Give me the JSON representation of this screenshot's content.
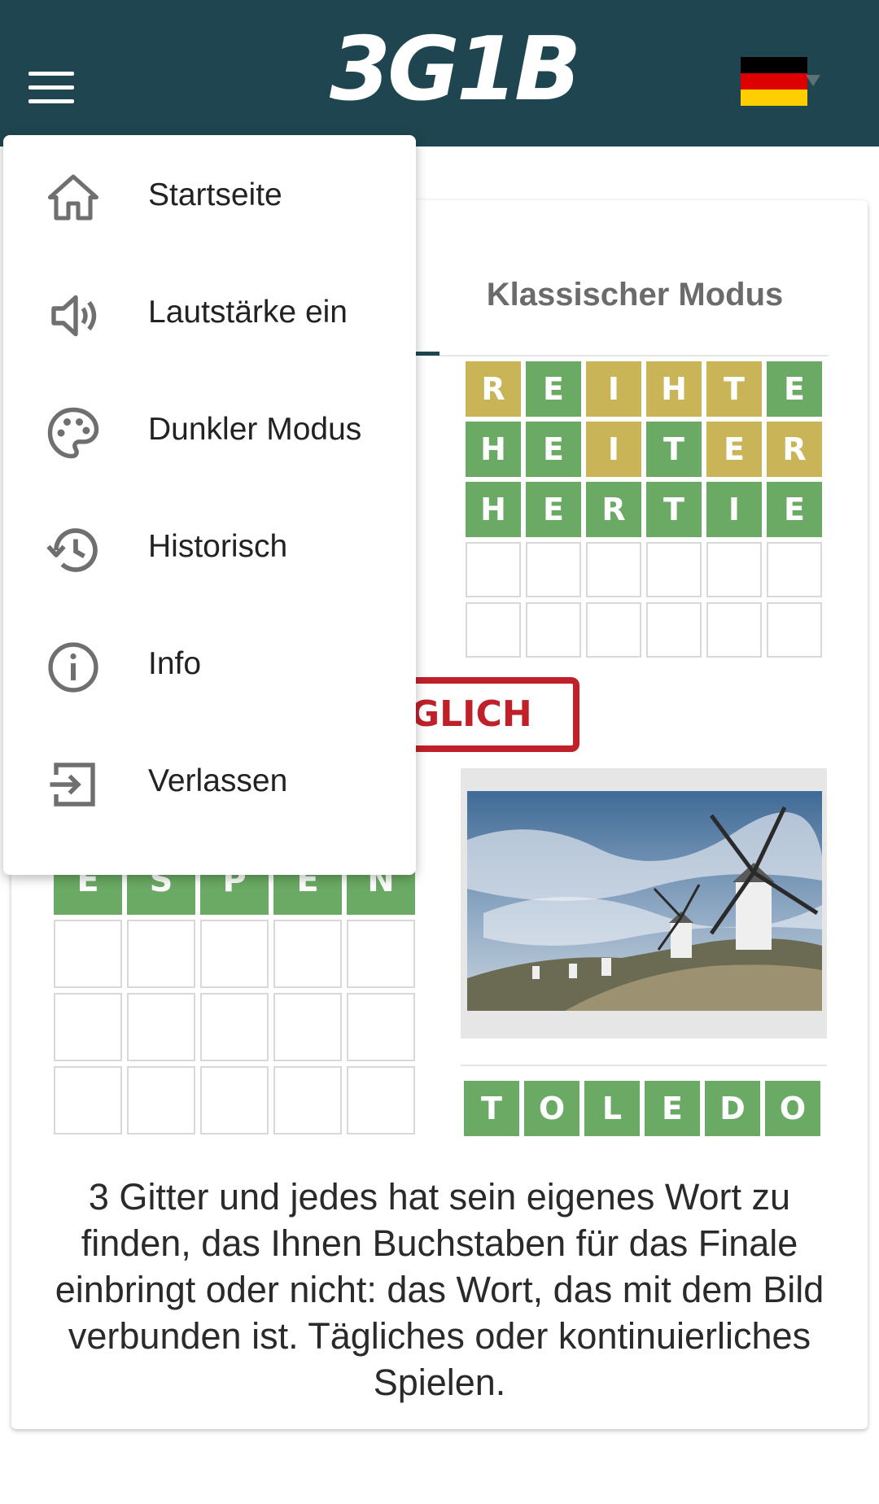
{
  "header": {
    "logo": "3G1B",
    "language_flag": "de",
    "colors": {
      "bar": "#1f4650"
    }
  },
  "tabs": [
    {
      "label": "Klassischer Modus"
    }
  ],
  "grid_right": {
    "rows": [
      {
        "letters": [
          "R",
          "E",
          "I",
          "H",
          "T",
          "E"
        ],
        "states": [
          "y",
          "g",
          "y",
          "y",
          "y",
          "g"
        ]
      },
      {
        "letters": [
          "H",
          "E",
          "I",
          "T",
          "E",
          "R"
        ],
        "states": [
          "g",
          "g",
          "y",
          "g",
          "y",
          "y"
        ]
      },
      {
        "letters": [
          "H",
          "E",
          "R",
          "T",
          "I",
          "E"
        ],
        "states": [
          "g",
          "g",
          "g",
          "g",
          "g",
          "g"
        ]
      },
      {
        "letters": [
          "",
          "",
          "",
          "",
          "",
          ""
        ],
        "states": [
          "w",
          "w",
          "w",
          "w",
          "w",
          "w"
        ]
      },
      {
        "letters": [
          "",
          "",
          "",
          "",
          "",
          ""
        ],
        "states": [
          "w",
          "w",
          "w",
          "w",
          "w",
          "w"
        ]
      }
    ]
  },
  "grid_left": {
    "rows": [
      {
        "letters": [
          "E",
          "S",
          "P",
          "E",
          "N"
        ],
        "states": [
          "g",
          "g",
          "g",
          "g",
          "g"
        ]
      },
      {
        "letters": [
          "",
          "",
          "",
          "",
          ""
        ],
        "states": [
          "w",
          "w",
          "w",
          "w",
          "w"
        ]
      },
      {
        "letters": [
          "",
          "",
          "",
          "",
          ""
        ],
        "states": [
          "w",
          "w",
          "w",
          "w",
          "w"
        ]
      },
      {
        "letters": [
          "",
          "",
          "",
          "",
          ""
        ],
        "states": [
          "w",
          "w",
          "w",
          "w",
          "w"
        ]
      }
    ]
  },
  "stamp": {
    "text": "GLICH"
  },
  "answer": {
    "letters": [
      "T",
      "O",
      "L",
      "E",
      "D",
      "O"
    ]
  },
  "description": "3 Gitter und jedes hat sein eigenes Wort zu finden, das Ihnen Buchstaben für das Finale einbringt oder nicht: das Wort, das mit dem Bild verbunden ist. Tägliches oder kontinuierliches Spielen.",
  "menu": {
    "items": [
      {
        "label": "Startseite",
        "icon": "home-icon"
      },
      {
        "label": "Lautstärke ein",
        "icon": "volume-icon"
      },
      {
        "label": "Dunkler Modus",
        "icon": "palette-icon"
      },
      {
        "label": "Historisch",
        "icon": "history-icon"
      },
      {
        "label": "Info",
        "icon": "info-icon"
      },
      {
        "label": "Verlassen",
        "icon": "exit-icon"
      }
    ]
  },
  "colors": {
    "green": "#6aaa64",
    "yellow": "#c9b458",
    "stamp_red": "#c0202a"
  }
}
